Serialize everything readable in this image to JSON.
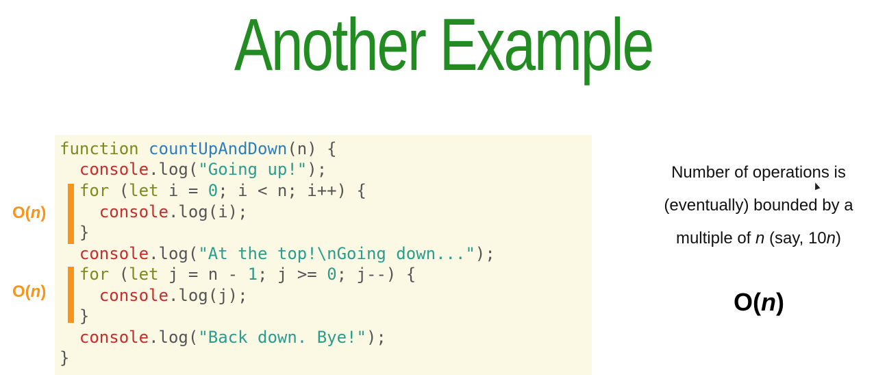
{
  "title": "Another Example",
  "code": {
    "line1": {
      "kw": "function",
      "name": "countUpAndDown",
      "rest": "(n) {"
    },
    "line2": {
      "obj": "console",
      "mid": ".log(",
      "str": "\"Going up!\"",
      "end": ");"
    },
    "line3": {
      "kw": "for",
      "mid1": " (",
      "kw2": "let",
      "mid2": " i = ",
      "num": "0",
      "rest": "; i < n; i++) {"
    },
    "line4": {
      "obj": "console",
      "rest": ".log(i);"
    },
    "line5": "}",
    "line6": {
      "obj": "console",
      "mid": ".log(",
      "str": "\"At the top!\\nGoing down...\"",
      "end": ");"
    },
    "line7": {
      "kw": "for",
      "mid1": " (",
      "kw2": "let",
      "mid2": " j = n - ",
      "num1": "1",
      "mid3": "; j >= ",
      "num2": "0",
      "rest": "; j--) {"
    },
    "line8": {
      "obj": "console",
      "rest": ".log(j);"
    },
    "line9": "}",
    "line10": {
      "obj": "console",
      "mid": ".log(",
      "str": "\"Back down. Bye!\"",
      "end": ");"
    },
    "line11": "}"
  },
  "labels": {
    "loop1": {
      "prefix": "O(",
      "var": "n",
      "suffix": ")"
    },
    "loop2": {
      "prefix": "O(",
      "var": "n",
      "suffix": ")"
    }
  },
  "explanation": {
    "line1": "Number of operations is",
    "line2": "(eventually) bounded by a",
    "line3_a": "multiple of ",
    "line3_var": "n",
    "line3_b": " (say, 10",
    "line3_var2": "n",
    "line3_c": ")"
  },
  "result": {
    "prefix": "O(",
    "var": "n",
    "suffix": ")"
  },
  "colors": {
    "title": "#228b22",
    "code_bg": "#fbf8e3",
    "keyword": "#7a8a1e",
    "function_name": "#2a7fbf",
    "console": "#c42d2d",
    "string": "#2a9d8f",
    "bar": "#f7941d"
  }
}
